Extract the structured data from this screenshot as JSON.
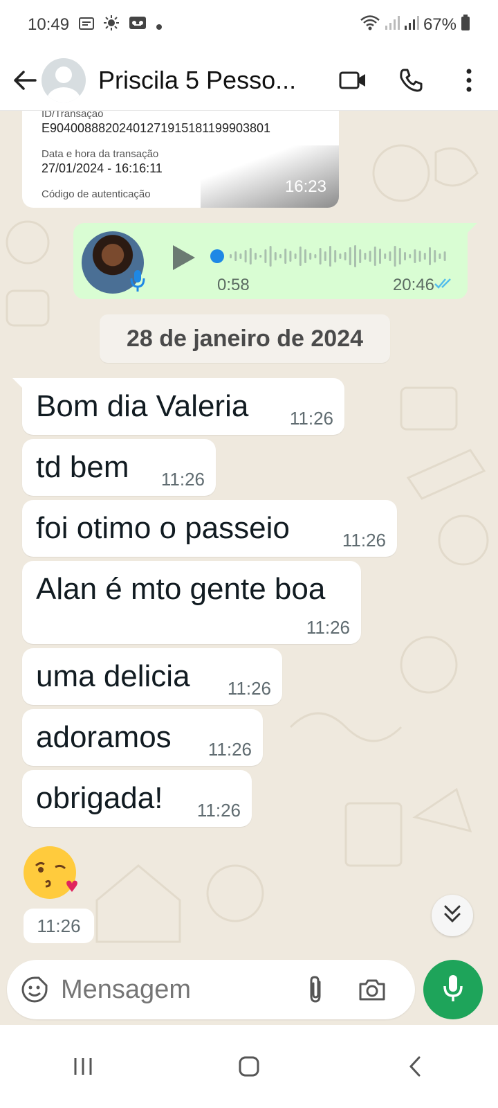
{
  "status_bar": {
    "time": "10:49",
    "battery": "67%",
    "icons": [
      "message-icon",
      "sun-icon",
      "voicemail-icon",
      "dot-icon",
      "wifi-icon",
      "signal-icon",
      "signal-icon",
      "battery-icon"
    ]
  },
  "header": {
    "contact_name": "Priscila 5 Pesso...",
    "icons": [
      "back-arrow-icon",
      "avatar-placeholder-icon",
      "video-call-icon",
      "phone-call-icon",
      "more-vert-icon"
    ]
  },
  "receipt": {
    "label_id": "ID/Transação",
    "value_id": "E90400888202401271915181199903801",
    "label_datetime": "Data e hora da transação",
    "value_datetime": "27/01/2024 - 16:16:11",
    "label_auth": "Código de autenticação",
    "time": "16:23"
  },
  "voice_message": {
    "duration": "0:58",
    "time": "20:46",
    "icons": [
      "play-icon",
      "mic-icon",
      "double-check-icon"
    ]
  },
  "date_separator": "28 de janeiro de 2024",
  "messages": [
    {
      "text": "Bom dia Valeria",
      "time": "11:26"
    },
    {
      "text": "td bem",
      "time": "11:26"
    },
    {
      "text": "foi otimo o passeio",
      "time": "11:26"
    },
    {
      "text": "Alan é mto gente boa",
      "time": "11:26"
    },
    {
      "text": "uma delicia",
      "time": "11:26"
    },
    {
      "text": "adoramos",
      "time": "11:26"
    },
    {
      "text": "obrigada!",
      "time": "11:26"
    }
  ],
  "emoji_message": {
    "emoji": "😘",
    "time": "11:26"
  },
  "composer": {
    "placeholder": "Mensagem",
    "icons": [
      "sticker-icon",
      "attach-icon",
      "camera-icon",
      "mic-icon"
    ]
  },
  "navbar": {
    "icons": [
      "recents-icon",
      "home-icon",
      "back-icon"
    ]
  },
  "colors": {
    "chat_bg": "#efe9de",
    "outgoing_bubble": "#d9fdd3",
    "incoming_bubble": "#ffffff",
    "mic_button": "#1ea45a",
    "read_ticks": "#53bdeb",
    "waveform_dot": "#1e88e5"
  }
}
